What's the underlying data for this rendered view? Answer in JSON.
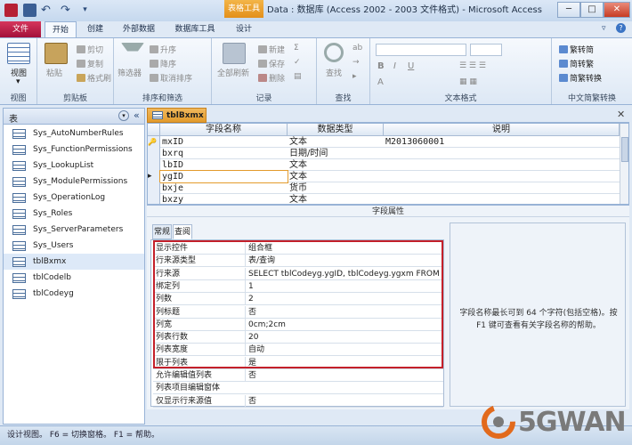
{
  "window": {
    "title": "Data : 数据库 (Access 2002 - 2003 文件格式)  -  Microsoft Access",
    "context_tab": "表格工具",
    "minimize": "─",
    "maximize": "□",
    "close": "✕"
  },
  "ribbon_tabs": [
    "文件",
    "开始",
    "创建",
    "外部数据",
    "数据库工具",
    "设计"
  ],
  "ribbon": {
    "view": {
      "label": "视图",
      "group": "视图"
    },
    "clipboard": {
      "paste": "粘贴",
      "cut": "剪切",
      "copy": "复制",
      "format_painter": "格式刷",
      "group": "剪贴板"
    },
    "sort_filter": {
      "filter": "筛选器",
      "ascending": "升序",
      "descending": "降序",
      "remove_sort": "取消排序",
      "group": "排序和筛选"
    },
    "records": {
      "refresh_all": "全部刷新",
      "new": "新建",
      "save": "保存",
      "delete": "删除",
      "group": "记录"
    },
    "find": {
      "find": "查找",
      "group": "查找"
    },
    "text_format": {
      "bold": "B",
      "italic": "I",
      "underline": "U",
      "group": "文本格式"
    },
    "chinese": {
      "trad_to_simp": "繁转简",
      "simp_to_trad": "简转繁",
      "convert": "简繁转换",
      "group": "中文简繁转换"
    }
  },
  "nav_pane": {
    "title": "表",
    "items": [
      "Sys_AutoNumberRules",
      "Sys_FunctionPermissions",
      "Sys_LookupList",
      "Sys_ModulePermissions",
      "Sys_OperationLog",
      "Sys_Roles",
      "Sys_ServerParameters",
      "Sys_Users",
      "tblBxmx",
      "tblCodelb",
      "tblCodeyg"
    ]
  },
  "document": {
    "tab_label": "tblBxmx",
    "columns": [
      "字段名称",
      "数据类型",
      "说明"
    ],
    "rows": [
      {
        "name": "mxID",
        "type": "文本",
        "desc": "M2013060001"
      },
      {
        "name": "bxrq",
        "type": "日期/时间",
        "desc": ""
      },
      {
        "name": "lbID",
        "type": "文本",
        "desc": ""
      },
      {
        "name": "ygID",
        "type": "文本",
        "desc": ""
      },
      {
        "name": "bxje",
        "type": "货币",
        "desc": ""
      },
      {
        "name": "bxzy",
        "type": "文本",
        "desc": ""
      }
    ]
  },
  "field_props": {
    "title": "字段属性",
    "tabs": [
      "常规",
      "查阅"
    ],
    "rows": [
      {
        "label": "显示控件",
        "value": "组合框"
      },
      {
        "label": "行来源类型",
        "value": "表/查询"
      },
      {
        "label": "行来源",
        "value": "SELECT tblCodeyg.ygID, tblCodeyg.ygxm FROM tbl"
      },
      {
        "label": "绑定列",
        "value": "1"
      },
      {
        "label": "列数",
        "value": "2"
      },
      {
        "label": "列标题",
        "value": "否"
      },
      {
        "label": "列宽",
        "value": "0cm;2cm"
      },
      {
        "label": "列表行数",
        "value": "20"
      },
      {
        "label": "列表宽度",
        "value": "自动"
      },
      {
        "label": "限于列表",
        "value": "是"
      },
      {
        "label": "允许编辑值列表",
        "value": "否"
      },
      {
        "label": "列表项目编辑窗体",
        "value": ""
      },
      {
        "label": "仅显示行来源值",
        "value": "否"
      }
    ],
    "help": "字段名称最长可到 64 个字符(包括空格)。按 F1 键可查看有关字段名称的帮助。"
  },
  "status": "设计视图。 F6 = 切换窗格。 F1 = 帮助。",
  "watermark": "5GWAN",
  "colors": {
    "accent": "#e39b2c",
    "highlight_box": "#c4202a",
    "file_tab": "#a3103a"
  }
}
